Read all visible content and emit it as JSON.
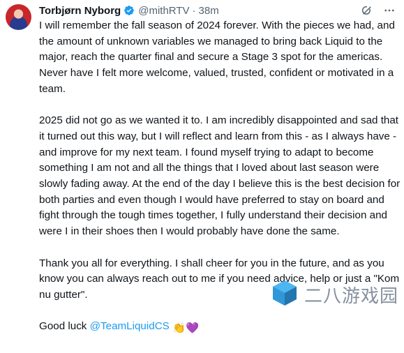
{
  "author": {
    "name": "Torbjørn Nyborg",
    "handle": "@mithRTV",
    "separator": "·",
    "time": "38m"
  },
  "icons": {
    "verified": "verified-badge-icon",
    "grok": "grok-icon",
    "more": "more-icon"
  },
  "tweet": {
    "p1": "I will remember the fall season of 2024 forever. With the pieces we had, and the amount of unknown variables we managed to bring back Liquid to the major, reach the quarter final and secure a Stage 3 spot for the americas. Never have I felt more welcome, valued, trusted, confident or motivated in a team.",
    "p2": "2025 did not go as we wanted it to. I am incredibly disappointed and sad that it turned out this way, but I will reflect and learn from this - as I always have - and improve for my next team. I found myself trying to adapt to become something I am not and all the things that I loved about last season were slowly fading away. At the end of the day I believe this is the best decision for both parties and even though I would have preferred to stay on board and fight through the tough times together, I fully understand their decision and were I in their shoes then I would probably have done the same.",
    "p3": "Thank you all for everything. I shall cheer for you in the future, and as you know you can always reach out to me if you need advice, help or just a \"Kom nu gutter\".",
    "p4_prefix": "Good luck ",
    "p4_mention": "@TeamLiquidCS",
    "p4_emojis": "👏💜"
  },
  "watermark": {
    "text": "二八游戏园"
  },
  "colors": {
    "accent": "#1d9bf0",
    "text": "#0f1419",
    "muted": "#536471"
  }
}
